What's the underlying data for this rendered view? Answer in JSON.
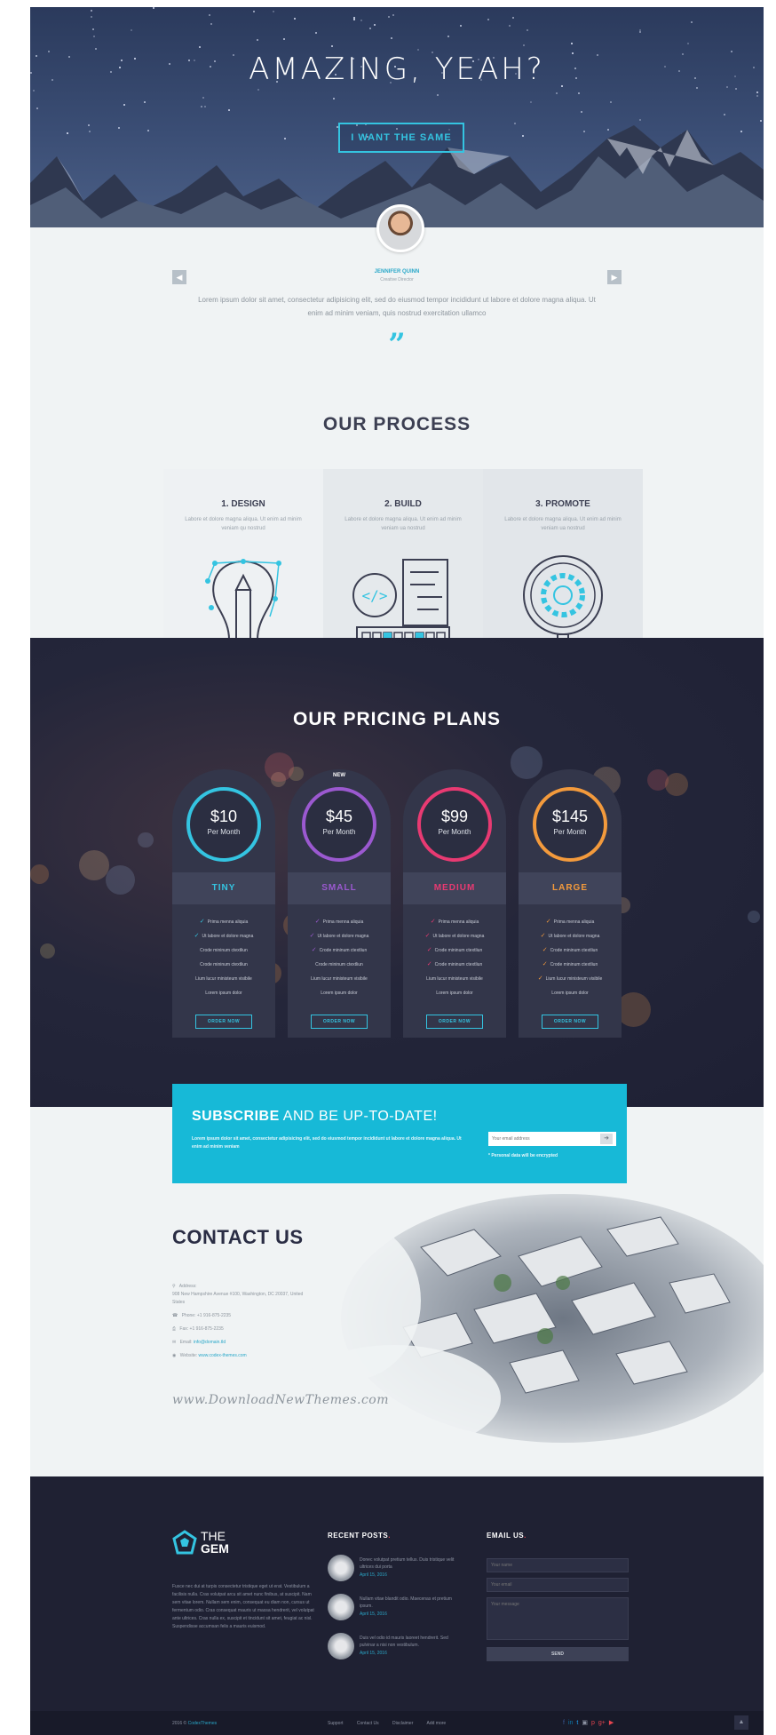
{
  "hero": {
    "title": "AMAZING, YEAH?",
    "button_label": "I WANT THE SAME"
  },
  "testimonial": {
    "name": "JENNIFER QUINN",
    "role": "Creative Director",
    "text": "Lorem ipsum dolor sit amet, consectetur adipisicing elit, sed do eiusmod tempor incididunt ut labore et dolore magna aliqua. Ut enim ad minim veniam, quis nostrud exercitation ullamco",
    "prev_icon": "chevron-left-icon",
    "next_icon": "chevron-right-icon",
    "quote_mark": "”"
  },
  "process": {
    "title_light": "OUR",
    "title_bold": "PROCESS",
    "steps": [
      {
        "title": "1. DESIGN",
        "text": "Labore et dolore magna aliqua. Ut enim ad minim veniam qu nostrud",
        "icon": "lightbulb-pencil-icon"
      },
      {
        "title": "2. BUILD",
        "text": "Labore et dolore magna aliqua. Ut enim ad minim veniam ua nostrud",
        "icon": "code-keyboard-icon"
      },
      {
        "title": "3. PROMOTE",
        "text": "Labore et dolore magna aliqua. Ut enim ad minim veniam ua nostrud",
        "icon": "magnifier-gear-icon"
      }
    ]
  },
  "pricing": {
    "title_light": "OUR",
    "title_bold": "PRICING PLANS",
    "plans": [
      {
        "price": "$10",
        "period": "Per Month",
        "name": "TINY",
        "color": "#34c4e1",
        "badge": "",
        "features": [
          "Prima menna aliquia",
          "Ut labore et dolore magna",
          "Crode mininum ctextliun",
          "Crode mininum ctextliun",
          "Lium lucur ministeum visibile",
          "Lorem ipsum dolor"
        ],
        "checked": 2,
        "cta": "ORDER NOW"
      },
      {
        "price": "$45",
        "period": "Per Month",
        "name": "SMALL",
        "color": "#9b59d0",
        "badge": "NEW",
        "features": [
          "Prima menna aliquia",
          "Ut labore et dolore magna",
          "Crode mininum ctextliun",
          "Crode mininum ctextliun",
          "Lium lucur ministeum visibile",
          "Lorem ipsum dolor"
        ],
        "checked": 3,
        "cta": "ORDER NOW"
      },
      {
        "price": "$99",
        "period": "Per Month",
        "name": "MEDIUM",
        "color": "#e83a72",
        "badge": "",
        "features": [
          "Prima menna aliquia",
          "Ut labore et dolore magna",
          "Crode mininum ctextliun",
          "Crode mininum ctextliun",
          "Lium lucur ministeum visibile",
          "Lorem ipsum dolor"
        ],
        "checked": 4,
        "cta": "ORDER NOW"
      },
      {
        "price": "$145",
        "period": "Per Month",
        "name": "LARGE",
        "color": "#f39a3c",
        "badge": "",
        "features": [
          "Prima menna aliquia",
          "Ut labore et dolore magna",
          "Crode mininum ctextliun",
          "Crode mininum ctextliun",
          "Lium lucur ministeum visibile",
          "Lorem ipsum dolor"
        ],
        "checked": 5,
        "cta": "ORDER NOW"
      }
    ]
  },
  "subscribe": {
    "title_bold": "SUBSCRIBE",
    "title_light": "AND BE UP-TO-DATE!",
    "text": "Lorem ipsum dolor sit amet, consectetur adipisicing elit, sed do eiusmod tempor incididunt ut labore et dolore magna aliqua. Ut enim ad minim veniam",
    "placeholder": "Your email address",
    "button_icon": "arrow-right-icon",
    "note": "* Personal data will be encrypted"
  },
  "contact": {
    "title_bold": "CONTACT",
    "title_light": "US",
    "address_label": "Address:",
    "address": "908 New Hampshire Avenue #100, Washington, DC 20037, United States",
    "phone": "Phone: +1 916-875-2235",
    "fax": "Fax: +1 916-875-2235",
    "email_label": "Email:",
    "email": "info@domain.tld",
    "website_label": "Website:",
    "website": "www.codex-themes.com",
    "watermark": "www.DownloadNewThemes.com"
  },
  "footer": {
    "logo_top": "THE",
    "logo_bottom": "GEM",
    "about": "Fusce nec dui at turpis consectetur tristique eget ut erat. Vestibulum a facilisis nulla. Cras volutpat arcu sit amet nunc finibus, at suscipit. Nam sem vitae lorem. Nullam sem enim, consequat eu diam non, cursus ut fermentum odio. Cras consequat mauris ut massa hendrerit, vel volutpat ante ultrices. Cras nulla ex, suscipit et tincidunt sit amet, feugiat ac nisl. Suspendisse accumsan felis a mauris euismod.",
    "recent_title": "RECENT POSTS",
    "posts": [
      {
        "text": "Donec volutpat pretium tellus. Duis tristique velit ultrices dui porta",
        "date": "April 15, 2016"
      },
      {
        "text": "Nullam vitae blandit odio. Maecenas et pretium ipsum.",
        "date": "April 15, 2016"
      },
      {
        "text": "Duis vel odio id mauris laoreet hendrerit. Sed pulvinar a nisi non vestibulum.",
        "date": "April 15, 2016"
      }
    ],
    "email_title": "EMAIL US",
    "name_placeholder": "Your name",
    "email_placeholder": "Your email",
    "message_placeholder": "Your message",
    "send_label": "SEND"
  },
  "bottom": {
    "copyright_prefix": "2016 ©",
    "copyright_brand": "CodexThemes",
    "links": [
      "Support",
      "Contact Us",
      "Disclaimer",
      "Add more"
    ],
    "socials": [
      {
        "icon": "facebook-icon",
        "glyph": "f",
        "color": "#3b5998"
      },
      {
        "icon": "linkedin-icon",
        "glyph": "in",
        "color": "#0e76a8"
      },
      {
        "icon": "twitter-icon",
        "glyph": "t",
        "color": "#1da1f2"
      },
      {
        "icon": "instagram-icon",
        "glyph": "▣",
        "color": "#8d93a3"
      },
      {
        "icon": "pinterest-icon",
        "glyph": "p",
        "color": "#e6454f"
      },
      {
        "icon": "googleplus-icon",
        "glyph": "g+",
        "color": "#e6454f"
      },
      {
        "icon": "youtube-icon",
        "glyph": "▶",
        "color": "#e6454f"
      }
    ],
    "totop_icon": "arrow-up-icon"
  }
}
